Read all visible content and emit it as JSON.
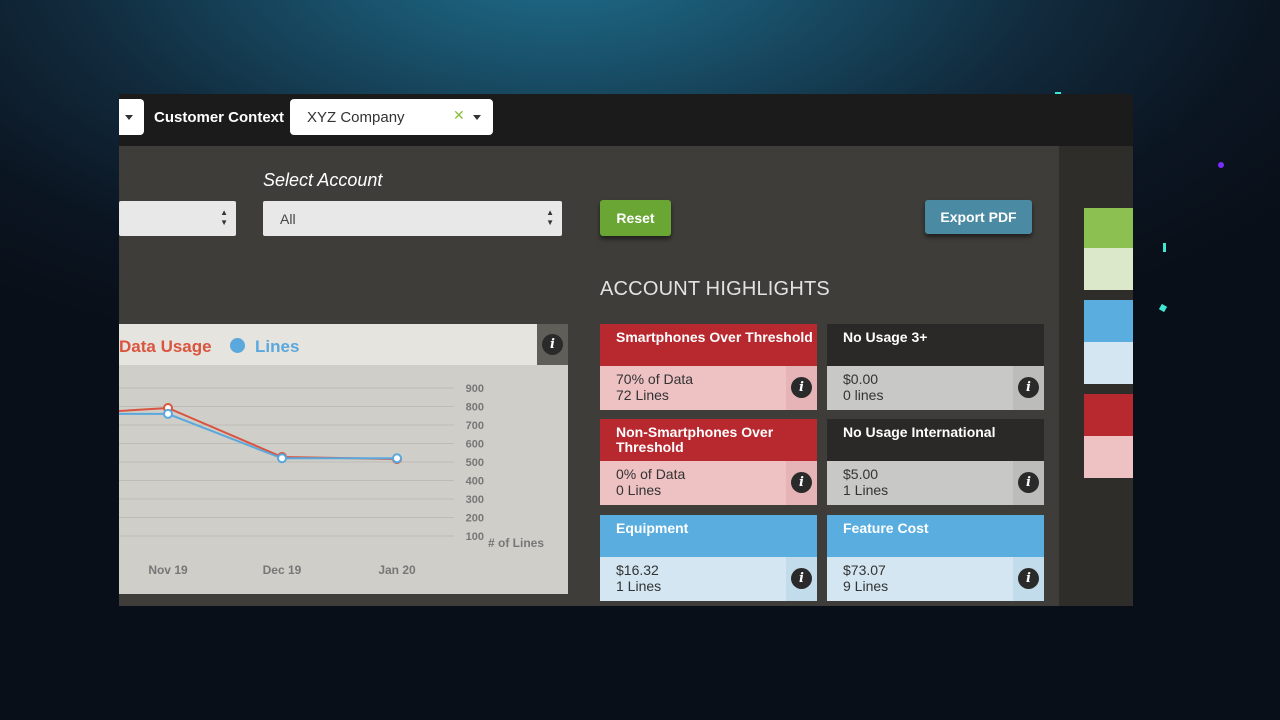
{
  "topbar": {
    "customer_context_label": "Customer Context",
    "customer_select_value": "XYZ Company",
    "clear_glyph": "✕"
  },
  "filters": {
    "select_account_label": "Select Account",
    "account_select_value": "All",
    "select_arrows": "▲▼"
  },
  "buttons": {
    "reset": "Reset",
    "export_pdf": "Export PDF"
  },
  "highlights": {
    "title": "ACCOUNT HIGHLIGHTS",
    "cards": [
      {
        "title": "Smartphones Over Threshold",
        "line1": "70% of Data",
        "line2": "72 Lines",
        "color": "red"
      },
      {
        "title": "No Usage 3+",
        "line1": "$0.00",
        "line2": "0 lines",
        "color": "dark"
      },
      {
        "title": "Non-Smartphones Over Threshold",
        "line1": "0% of Data",
        "line2": "0 Lines",
        "color": "red"
      },
      {
        "title": "No Usage International",
        "line1": "$5.00",
        "line2": "1 Lines",
        "color": "dark"
      },
      {
        "title": "Equipment",
        "line1": "$16.32",
        "line2": "1 Lines",
        "color": "blue"
      },
      {
        "title": "Feature Cost",
        "line1": "$73.07",
        "line2": "9 Lines",
        "color": "blue"
      }
    ],
    "info_glyph": "i"
  },
  "chart_data": {
    "type": "line",
    "categories": [
      "Nov 19",
      "Dec 19",
      "Jan 20"
    ],
    "series": [
      {
        "name": "Lines",
        "color": "#5aa8dc",
        "values": [
          760,
          520,
          520
        ]
      },
      {
        "name": "Data Usage",
        "color": "#d9553f",
        "values": null
      }
    ],
    "legend": [
      "Data Usage",
      "Lines"
    ],
    "y_right_ticks": [
      900,
      800,
      700,
      600,
      500,
      400,
      300,
      200,
      100
    ],
    "y_right_label": "# of Lines",
    "ylim": [
      100,
      900
    ],
    "info_glyph": "i"
  },
  "colors": {
    "accent_green": "#6aa634",
    "export_blue": "#4b8aa3",
    "alert_red": "#b8282f",
    "lines_blue": "#5aa8dc",
    "data_red": "#d9553f"
  }
}
